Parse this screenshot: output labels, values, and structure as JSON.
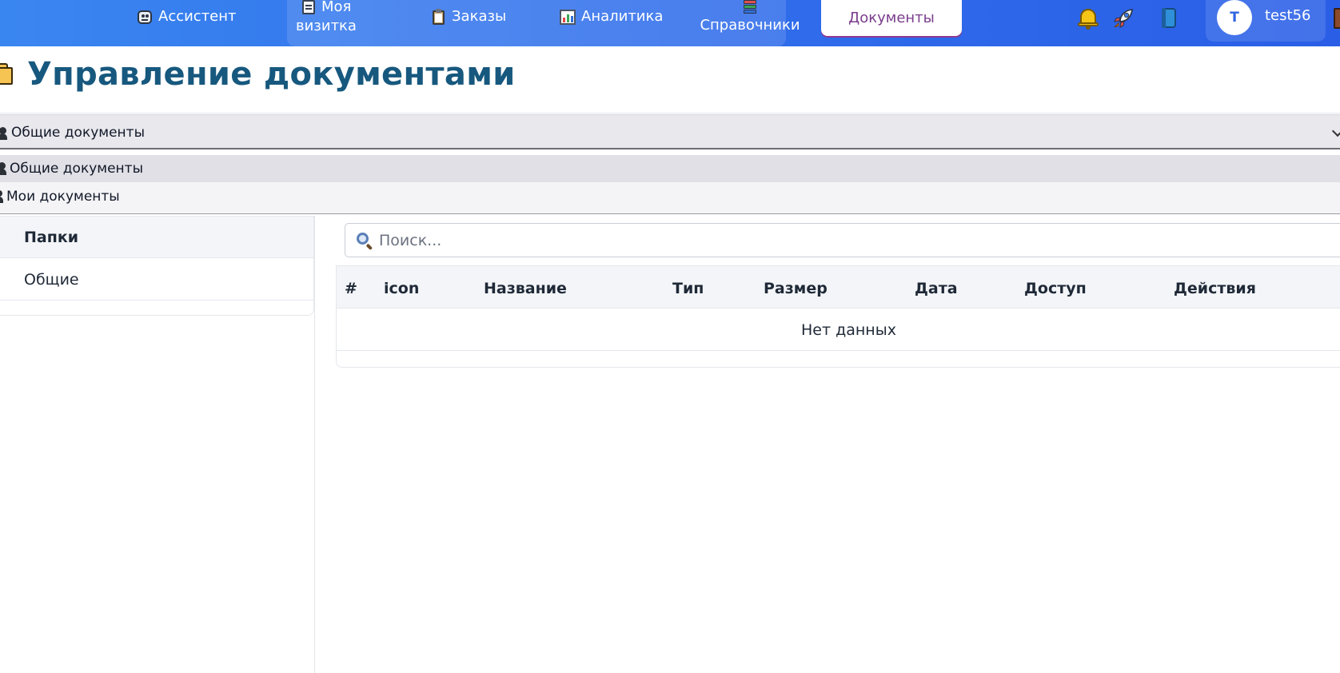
{
  "nav": {
    "items": [
      {
        "label": "Ассистент",
        "icon": "robot-icon"
      },
      {
        "label_line1": "Моя",
        "label_line2": "визитка",
        "icon": "card-icon"
      },
      {
        "label": "Заказы",
        "icon": "clipboard-icon"
      },
      {
        "label": "Аналитика",
        "icon": "chart-icon"
      },
      {
        "label": "Справочники",
        "icon": "books-icon"
      }
    ],
    "active_tab": "Документы",
    "actions": [
      "bell-icon",
      "rocket-icon",
      "book-icon"
    ],
    "user": {
      "initial": "T",
      "name": "test56"
    }
  },
  "header": {
    "title": "Управление документами",
    "icon": "folder-icon"
  },
  "scope_select": {
    "selected": "Общие документы",
    "options": [
      "Общие документы",
      "Мои документы"
    ]
  },
  "sidebar": {
    "title": "Папки",
    "folders": [
      "Общие"
    ]
  },
  "main": {
    "search": {
      "placeholder": "Поиск...",
      "value": ""
    },
    "table": {
      "columns": [
        "#",
        "icon",
        "Название",
        "Тип",
        "Размер",
        "Дата",
        "Доступ",
        "Действия"
      ],
      "rows": [],
      "empty_text": "Нет данных"
    }
  },
  "colors": {
    "nav_start": "#3a86f0",
    "nav_end": "#2a5ee6",
    "title": "#17587e",
    "active_tab_text": "#7a3d8c"
  }
}
